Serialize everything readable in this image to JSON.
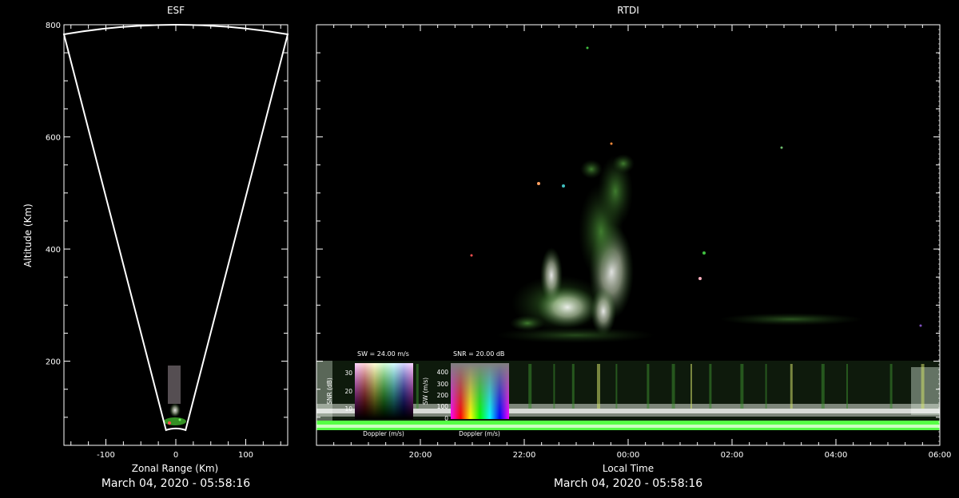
{
  "colors": {
    "background": "#000000",
    "foreground": "#ffffff",
    "echo_green": "#46b43a",
    "band_green": "#55ff44"
  },
  "esf": {
    "title": "ESF",
    "xlabel": "Zonal Range (Km)",
    "ylabel": "Altitude (Km)",
    "date": "March 04, 2020 - 05:58:16"
  },
  "rtdi": {
    "title": "RTDI",
    "xlabel": "Local Time",
    "date": "March 04, 2020 - 05:58:16"
  },
  "legends": {
    "sw": {
      "title": "SW = 24.00 m/s",
      "ylabel": "SNR (dB)",
      "xlabel": "Doppler (m/s)",
      "ticks": [
        "30",
        "20",
        "10"
      ]
    },
    "snr": {
      "title": "SNR = 20.00 dB",
      "ylabel": "SW (m/s)",
      "xlabel": "Doppler (m/s)",
      "ticks": [
        "400",
        "300",
        "200",
        "100",
        "0"
      ]
    }
  },
  "chart_data": [
    {
      "type": "scatter",
      "panel": "ESF",
      "title": "ESF",
      "xlabel": "Zonal Range (Km)",
      "ylabel": "Altitude (Km)",
      "xlim": [
        -160,
        160
      ],
      "ylim": [
        50,
        800
      ],
      "xticks": [
        -100,
        0,
        100
      ],
      "yticks": [
        200,
        400,
        600,
        800
      ],
      "fan_outline": {
        "x_at_top": [
          -160,
          160
        ],
        "top_altitude": 800,
        "apex_altitude": 80
      },
      "echo_extent": {
        "x": [
          -15,
          10
        ],
        "altitude": [
          80,
          190
        ]
      }
    },
    {
      "type": "heatmap",
      "panel": "RTDI",
      "title": "RTDI",
      "xlabel": "Local Time",
      "ylabel": "",
      "xlim": [
        "18:00",
        "06:00"
      ],
      "ylim": [
        50,
        800
      ],
      "xticks": [
        "20:00",
        "22:00",
        "00:00",
        "02:00",
        "04:00",
        "06:00"
      ],
      "plume_extent": {
        "time": [
          "21:50",
          "00:10"
        ],
        "altitude": [
          200,
          560
        ]
      },
      "bottom_band_altitude": [
        80,
        200
      ]
    }
  ]
}
